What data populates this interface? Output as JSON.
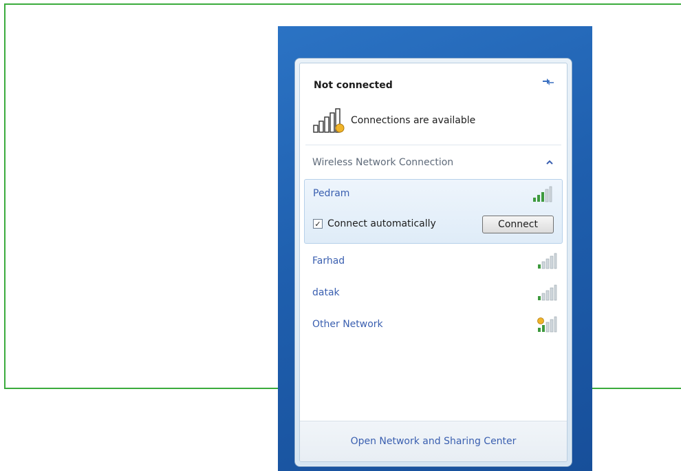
{
  "status": {
    "title": "Not connected",
    "availability": "Connections are available",
    "refresh_icon": "refresh-icon",
    "availability_icon": "wireless-signal-warning-icon"
  },
  "section": {
    "label": "Wireless Network Connection",
    "collapse_icon": "chevron-up-icon"
  },
  "selected_network": {
    "name": "Pedram",
    "signal_icon": "signal-strength-icon",
    "connect_automatically": {
      "label": "Connect automatically",
      "checked": true
    },
    "connect_button": {
      "label": "Connect"
    }
  },
  "networks": [
    {
      "name": "Farhad",
      "signal_icon": "signal-strength-icon"
    },
    {
      "name": "datak",
      "signal_icon": "signal-strength-icon"
    },
    {
      "name": "Other Network",
      "signal_icon": "signal-strength-unsecured-icon"
    }
  ],
  "footer": {
    "link": "Open Network and Sharing Center"
  },
  "colors": {
    "frame_line": "#3aab3c",
    "link": "#3a5fb0",
    "desktop": "#1f5fae",
    "selection": "#dfecf8"
  }
}
